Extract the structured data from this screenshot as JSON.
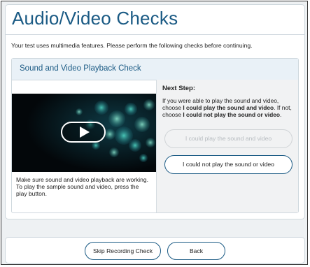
{
  "page": {
    "title": "Audio/Video Checks",
    "intro": "Your test uses multimedia features. Please perform the following checks before continuing."
  },
  "panel": {
    "title": "Sound and Video Playback Check",
    "left_note": "Make sure sound and video playback are working. To play the sample sound and video, press the play button.",
    "next_step": {
      "heading": "Next Step:",
      "text_prefix": "If you were able to play the sound and video, choose ",
      "text_bold1": "I could play the sound and video",
      "text_middle": ". If not, choose ",
      "text_bold2": "I could not play the sound or video",
      "text_suffix": "."
    },
    "buttons": {
      "could_play": "I could play the sound and video",
      "could_not_play": "I could not play the sound or video"
    }
  },
  "footer": {
    "skip_label": "Skip Recording Check",
    "back_label": "Back"
  },
  "colors": {
    "accent": "#1a5a84",
    "panel_header_bg": "#e9f1f7",
    "page_bg": "#eef1f3",
    "disabled_text": "#b7bcc0"
  },
  "icons": {
    "play": "play-icon"
  }
}
